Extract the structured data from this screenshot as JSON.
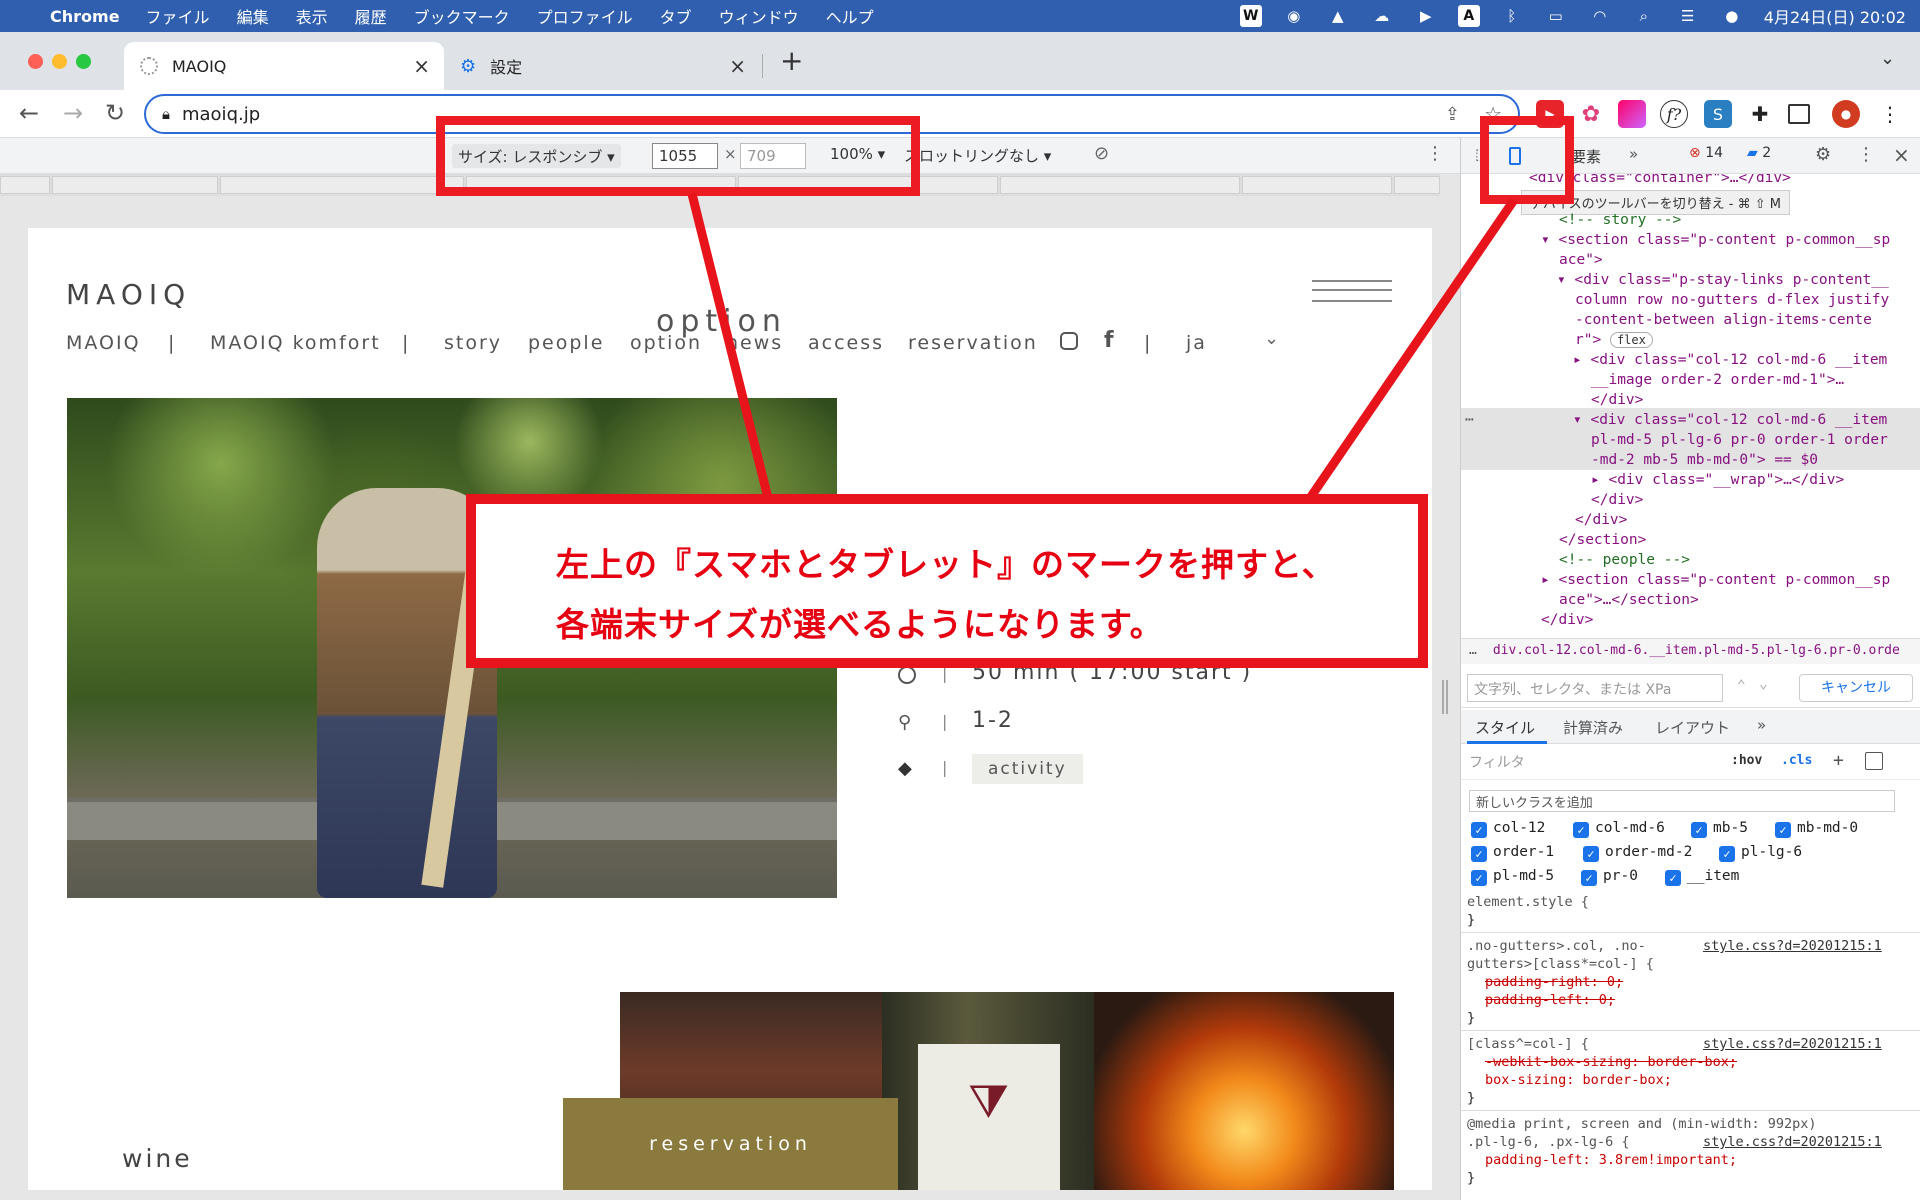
{
  "menubar": {
    "app": "Chrome",
    "items": [
      "ファイル",
      "編集",
      "表示",
      "履歴",
      "ブックマーク",
      "プロファイル",
      "タブ",
      "ウィンドウ",
      "ヘルプ"
    ],
    "datetime": "4月24日(日) 20:02"
  },
  "tabs": [
    {
      "label": "MAOIQ",
      "active": true
    },
    {
      "label": "設定",
      "active": false
    }
  ],
  "url": "maoiq.jp",
  "device_toolbar": {
    "size_label": "サイズ: レスポンシブ ▾",
    "width": "1055",
    "times": "×",
    "height_placeholder": "709",
    "zoom": "100% ▾",
    "throttle": "スロットリングなし ▾"
  },
  "site": {
    "logo": "MAOIQ",
    "heading": "option",
    "nav": [
      "MAOIQ",
      "|",
      "MAOIQ komfort",
      "|",
      "story",
      "people",
      "option",
      "news",
      "access",
      "reservation",
      "|",
      "ja"
    ],
    "duration": "50 min ( 17:00 start )",
    "people": "1-2",
    "tag": "activity",
    "reservation_button": "reservation",
    "wine_label": "wine"
  },
  "devtools": {
    "panel_tab": "要素",
    "errors": "14",
    "messages": "2",
    "tooltip": "デバイスのツールバーを切り替え - ⌘ ⇧ M",
    "breadcrumb": "div.col-12.col-md-6.__item.pl-md-5.pl-lg-6.pr-0.orde",
    "search_placeholder": "文字列、セレクタ、または XPa",
    "cancel": "キャンセル",
    "style_tabs": [
      "スタイル",
      "計算済み",
      "レイアウト"
    ],
    "filter_placeholder": "フィルタ",
    "hov": ":hov",
    "cls": ".cls",
    "new_class_placeholder": "新しいクラスを追加",
    "classes": [
      "col-12",
      "col-md-6",
      "mb-5",
      "mb-md-0",
      "order-1",
      "order-md-2",
      "pl-lg-6",
      "pl-md-5",
      "pr-0",
      "__item"
    ],
    "dom_lines": [
      "<div class=\"container\">…</div>",
      "<!-- story -->",
      "<section class=\"p-content p-common__sp",
      "ace\">",
      "<div class=\"p-stay-links p-content__",
      "column row no-gutters d-flex justify",
      "-content-between align-items-cente",
      "r\">",
      "flex",
      "<div class=\"col-12 col-md-6 __item",
      "__image order-2 order-md-1\">…",
      "</div>",
      "<div class=\"col-12 col-md-6 __item",
      "pl-md-5 pl-lg-6 pr-0 order-1 order",
      "-md-2 mb-5 mb-md-0\"> == $0",
      "<div class=\"__wrap\">…</div>",
      "</div>",
      "</div>",
      "</section>",
      "<!-- people -->",
      "<section class=\"p-content p-common__sp",
      "ace\">…</section>",
      "</div>"
    ],
    "css": {
      "element_style": "element.style {",
      "close": "}",
      "rule1_sel": ".no-gutters>.col, .no-",
      "rule1_sel2": "gutters>[class*=col-] {",
      "rule1_src": "style.css?d=20201215:1",
      "rule1_p1": "padding-right: 0;",
      "rule1_p2": "padding-left: 0;",
      "rule2_sel": "[class^=col-] {",
      "rule2_src": "style.css?d=20201215:1",
      "rule2_p1": "-webkit-box-sizing: border-box;",
      "rule2_p2": "box-sizing: border-box;",
      "rule3_media": "@media print, screen and (min-width: 992px)",
      "rule3_sel": ".pl-lg-6, .px-lg-6 {",
      "rule3_src": "style.css?d=20201215:1",
      "rule3_p1": "padding-left: 3.8rem!important;"
    }
  },
  "annotation": {
    "line1": "左上の『スマホとタブレット』のマークを押すと、",
    "line2": "各端末サイズが選べるようになります。",
    "color": "#e60012"
  }
}
